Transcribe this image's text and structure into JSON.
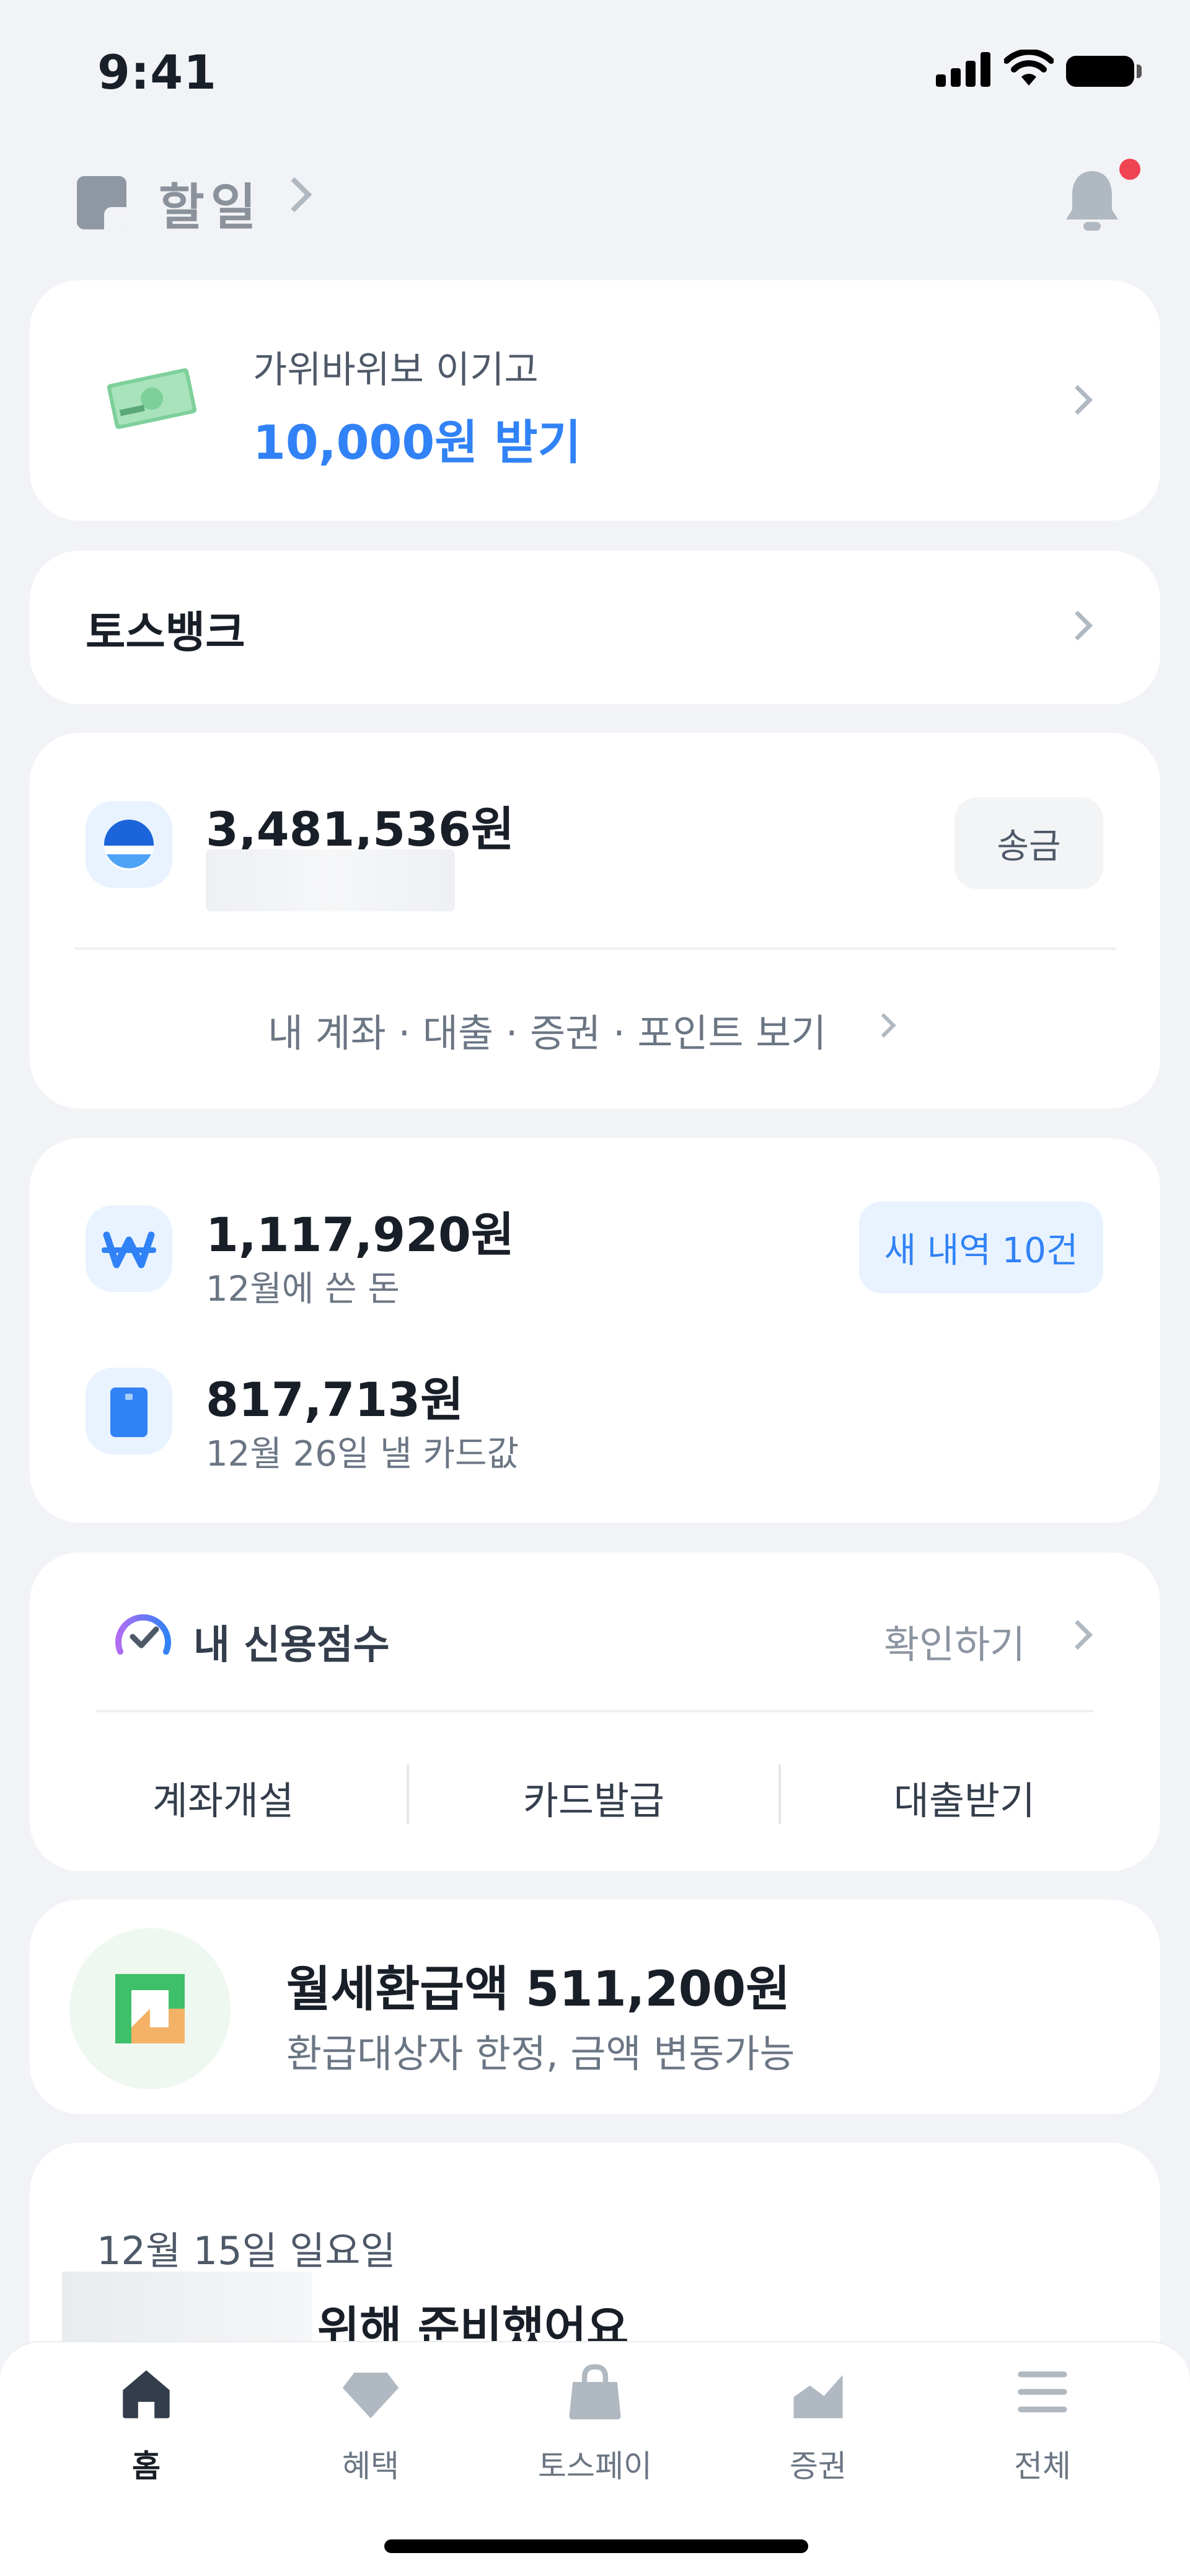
{
  "status_bar": {
    "time": "9:41"
  },
  "top_bar": {
    "todo_label": "할일"
  },
  "promo": {
    "subtitle": "가위바위보 이기고",
    "title": "10,000원 받기"
  },
  "bank": {
    "title": "토스뱅크"
  },
  "account": {
    "balance": "3,481,536원",
    "send_label": "송금",
    "links_label": "내 계좌 · 대출 · 증권 · 포인트 보기"
  },
  "spending": {
    "amount": "1,117,920원",
    "subtitle": "12월에 쓴 돈",
    "new_label": "새 내역 10건",
    "card_amount": "817,713원",
    "card_subtitle": "12월 26일 낼 카드값"
  },
  "credit": {
    "label": "내 신용점수",
    "check_label": "확인하기",
    "quick_actions": [
      "계좌개설",
      "카드발급",
      "대출받기"
    ]
  },
  "rent": {
    "title": "월세환급액 511,200원",
    "subtitle": "환급대상자 한정, 금액 변동가능"
  },
  "feed": {
    "date": "12월 15일 일요일",
    "title_partial": "위해 준비했어요"
  },
  "tabs": [
    {
      "label": "홈",
      "icon": "home-icon",
      "active": true
    },
    {
      "label": "혜택",
      "icon": "diamond-icon",
      "active": false
    },
    {
      "label": "토스페이",
      "icon": "shopping-bag-icon",
      "active": false
    },
    {
      "label": "증권",
      "icon": "chart-icon",
      "active": false
    },
    {
      "label": "전체",
      "icon": "menu-icon",
      "active": false
    }
  ],
  "colors": {
    "accent": "#3182f6",
    "background": "#f2f3f6",
    "notification": "#f04452"
  }
}
